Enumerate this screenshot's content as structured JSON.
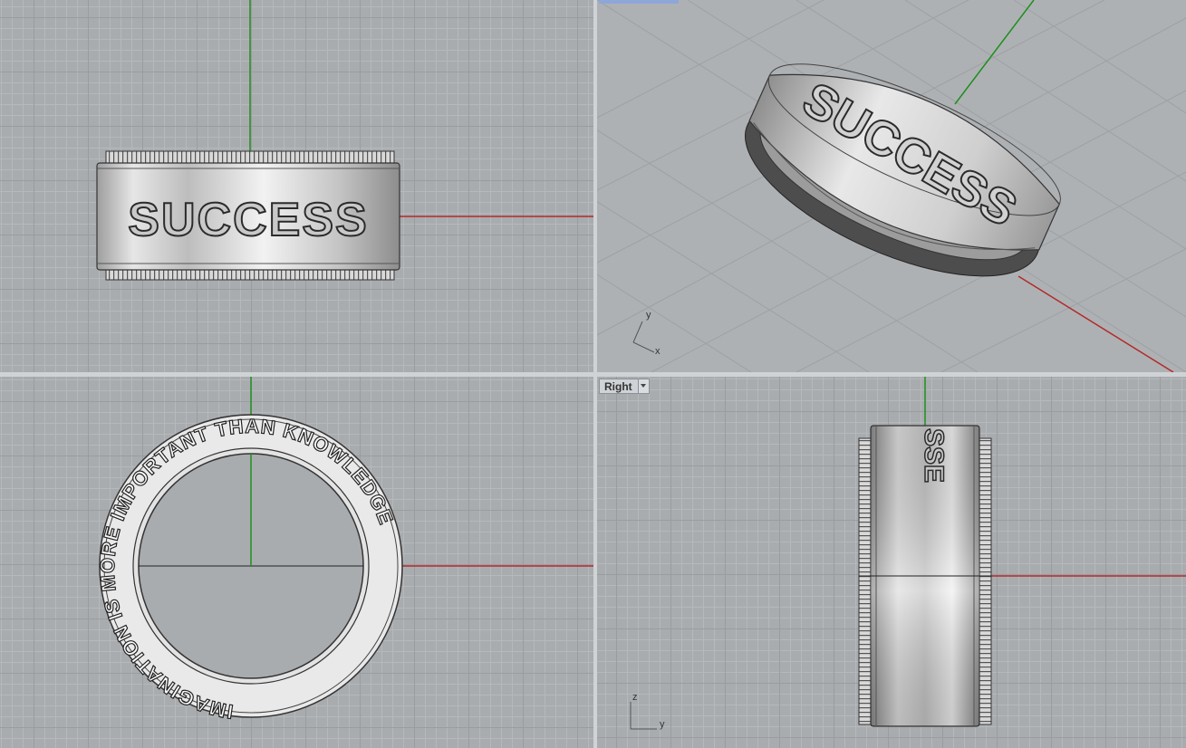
{
  "viewports": {
    "front": {
      "engraving": "SUCCESS"
    },
    "perspective": {
      "engraving": "SUCCESS",
      "axis_x": "x",
      "axis_y": "y"
    },
    "top": {
      "inscription": "IMAGINATION IS MORE IMPORTANT THAN KNOWLEDGE"
    },
    "right": {
      "label": "Right",
      "engraving": "SSE",
      "axis_z": "z",
      "axis_y": "y"
    }
  },
  "colors": {
    "x_axis": "#b32a2a",
    "y_axis": "#1f8f1f",
    "grid": "#a9acaf",
    "ring": "#cfcfcf"
  }
}
